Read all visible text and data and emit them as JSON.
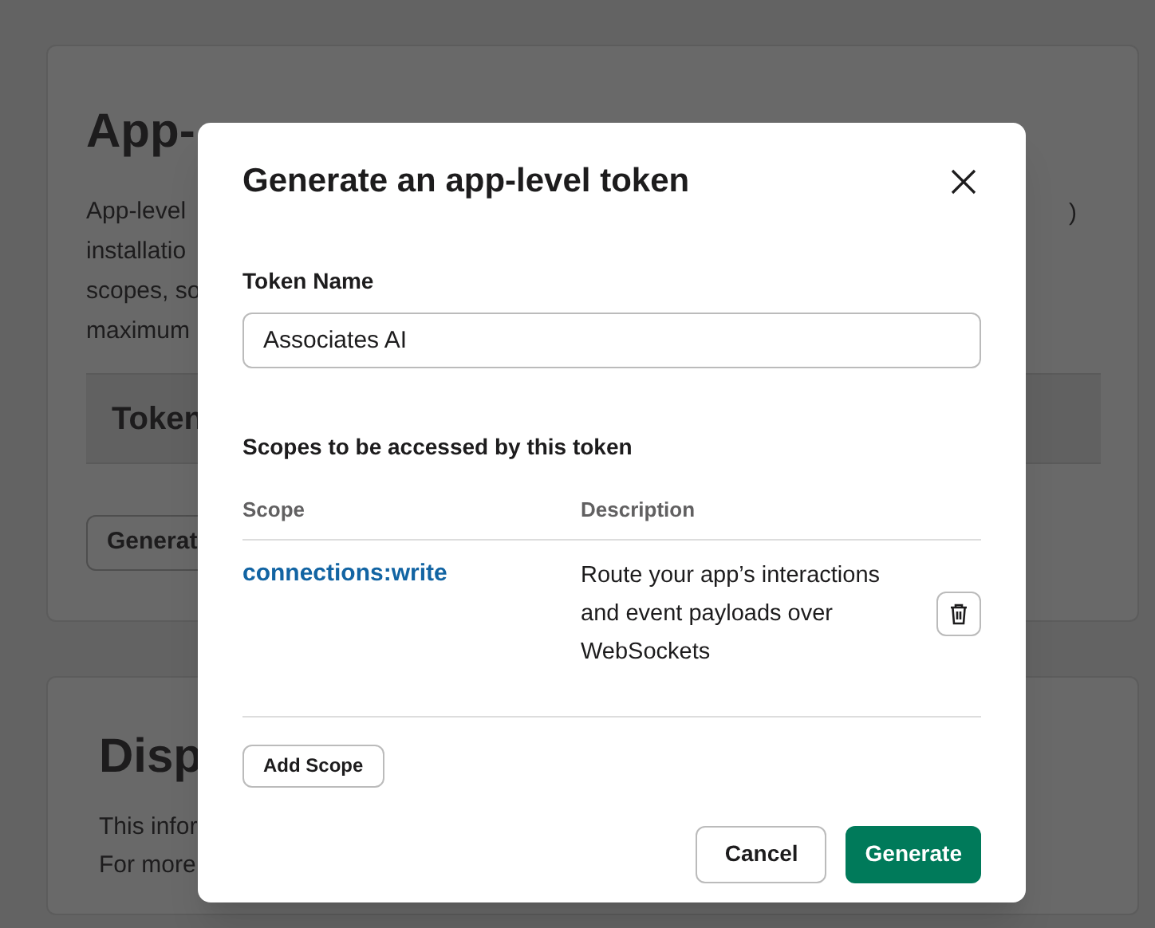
{
  "background": {
    "tokens_card": {
      "title": "App-",
      "paragraph_lines": [
        "App-level",
        "installatio",
        "scopes, so",
        "maximum"
      ],
      "paragraph_right_fragment": ")",
      "section_header": "Token",
      "button": "Generat"
    },
    "display_card": {
      "title": "Disp",
      "paragraph_lines": [
        "This infor",
        "For more"
      ]
    }
  },
  "dialog": {
    "title": "Generate an app-level token",
    "token_name": {
      "label": "Token Name",
      "value": "Associates AI"
    },
    "scopes_heading": "Scopes to be accessed by this token",
    "columns": [
      "Scope",
      "Description"
    ],
    "scopes": [
      {
        "scope": "connections:write",
        "description": "Route your app’s interactions and event payloads over WebSockets"
      }
    ],
    "add_button": "Add Scope",
    "buttons": [
      {
        "label": "Cancel",
        "kind": "secondary"
      },
      {
        "label": "Generate",
        "kind": "primary"
      }
    ]
  }
}
